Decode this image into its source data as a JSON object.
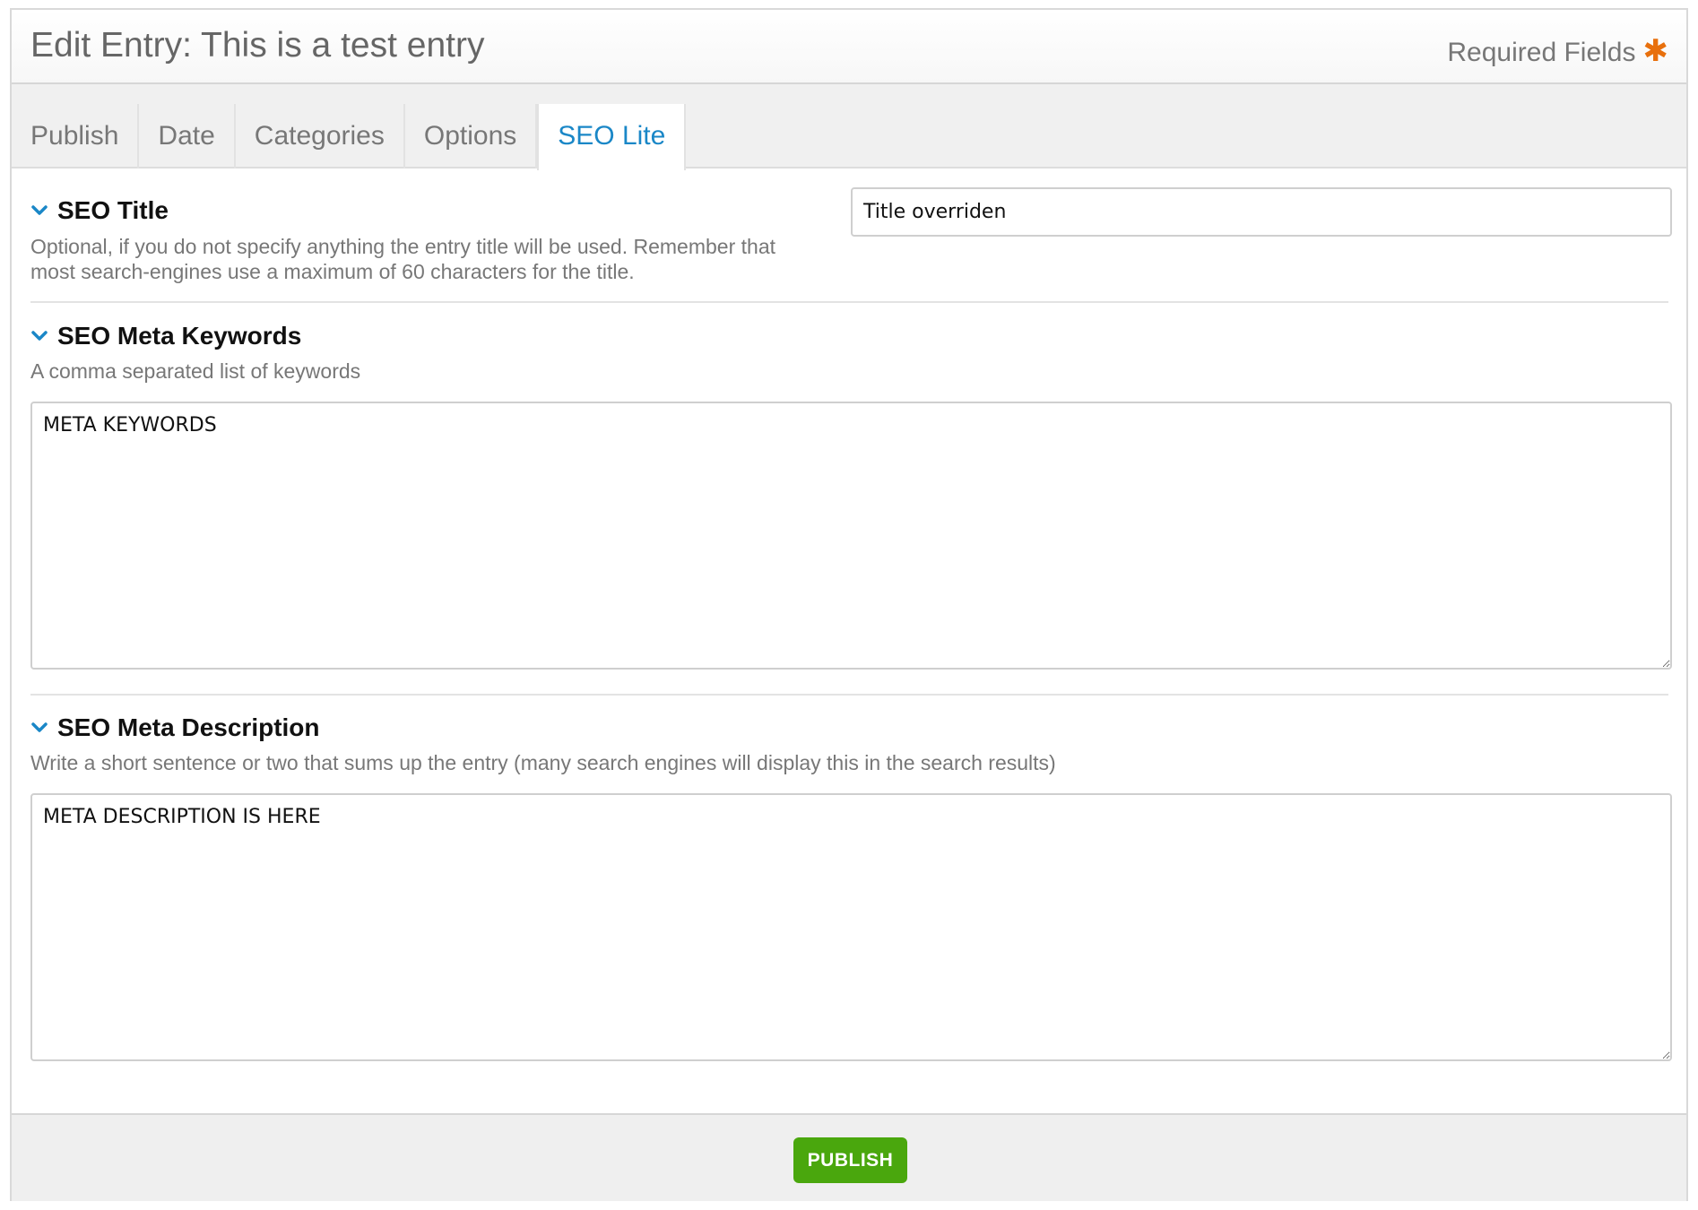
{
  "header": {
    "title": "Edit Entry: This is a test entry",
    "required_label": "Required Fields",
    "required_marker": "✱"
  },
  "tabs": [
    {
      "label": "Publish",
      "active": false
    },
    {
      "label": "Date",
      "active": false
    },
    {
      "label": "Categories",
      "active": false
    },
    {
      "label": "Options",
      "active": false
    },
    {
      "label": "SEO Lite",
      "active": true
    }
  ],
  "fields": {
    "seo_title": {
      "label": "SEO Title",
      "description": "Optional, if you do not specify anything the entry title will be used. Remember that most search-engines use a maximum of 60 characters for the title.",
      "value": "Title overriden"
    },
    "meta_keywords": {
      "label": "SEO Meta Keywords",
      "description": "A comma separated list of keywords",
      "value": "META KEYWORDS"
    },
    "meta_description": {
      "label": "SEO Meta Description",
      "description": "Write a short sentence or two that sums up the entry (many search engines will display this in the search results)",
      "value": "META DESCRIPTION IS HERE"
    }
  },
  "footer": {
    "publish_label": "PUBLISH"
  },
  "colors": {
    "accent": "#1a87c7",
    "required_star": "#e8700d",
    "publish_button": "#4aa70d"
  },
  "icons": {
    "section_toggle": "chevron-down-icon",
    "resize": "resize-handle-icon"
  }
}
